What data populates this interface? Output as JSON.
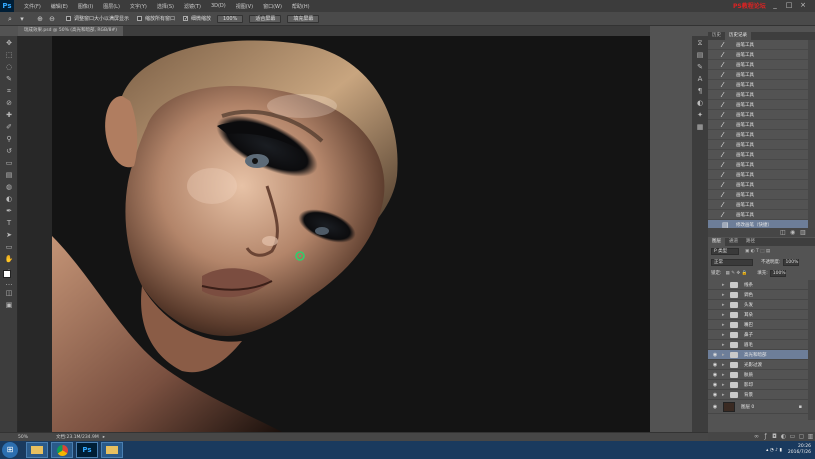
{
  "app": {
    "logo": "Ps",
    "menu": [
      "文件(F)",
      "编辑(E)",
      "图像(I)",
      "图层(L)",
      "文字(Y)",
      "选择(S)",
      "滤镜(T)",
      "3D(D)",
      "视图(V)",
      "窗口(W)",
      "帮助(H)"
    ],
    "watermark": "PS教程论坛",
    "window_controls": [
      "_",
      "□",
      "×"
    ]
  },
  "options": {
    "tool_icon": "zoom-tool-icon",
    "check1": "调整窗口大小以满屏显示",
    "check2": "缩放所有窗口",
    "check3": "细微缩放",
    "btn1": "100%",
    "btn2": "适合屏幕",
    "btn3": "填充屏幕"
  },
  "document": {
    "tab_title": "瑞成效果.psd @ 50% (高光和暗部, RGB/8#)"
  },
  "status": {
    "zoom": "50%",
    "doc_info": "文档:23.1M/234.9M"
  },
  "history": {
    "tabs": [
      "历史",
      "历史记录"
    ],
    "items": [
      "画笔工具",
      "画笔工具",
      "画笔工具",
      "画笔工具",
      "画笔工具",
      "画笔工具",
      "画笔工具",
      "画笔工具",
      "画笔工具",
      "画笔工具",
      "画笔工具",
      "画笔工具",
      "画笔工具",
      "画笔工具",
      "画笔工具",
      "画笔工具",
      "画笔工具",
      "画笔工具"
    ],
    "selected": "修改画笔（快捷）"
  },
  "layers": {
    "tabs": [
      "图层",
      "通道",
      "路径"
    ],
    "kind_label": "P 类型",
    "blend_mode": "正常",
    "opacity_label": "不透明度:",
    "opacity_value": "100%",
    "lock_label": "锁定:",
    "fill_label": "填充:",
    "fill_value": "100%",
    "groups": [
      "线条",
      "调色",
      "头发",
      "耳朵",
      "嘴巴",
      "鼻子",
      "眉毛",
      "高光和暗部",
      "光影过渡",
      "肤质",
      "影印",
      "背景"
    ],
    "selected_group": "高光和暗部",
    "background_layer": "图层 0"
  },
  "taskbar": {
    "start": "⊞",
    "apps": [
      "Ps"
    ],
    "time": "20:26",
    "date": "2016/7/26"
  },
  "colors": {
    "accent_selection": "#6d7e99",
    "watermark": "#dd2222"
  }
}
